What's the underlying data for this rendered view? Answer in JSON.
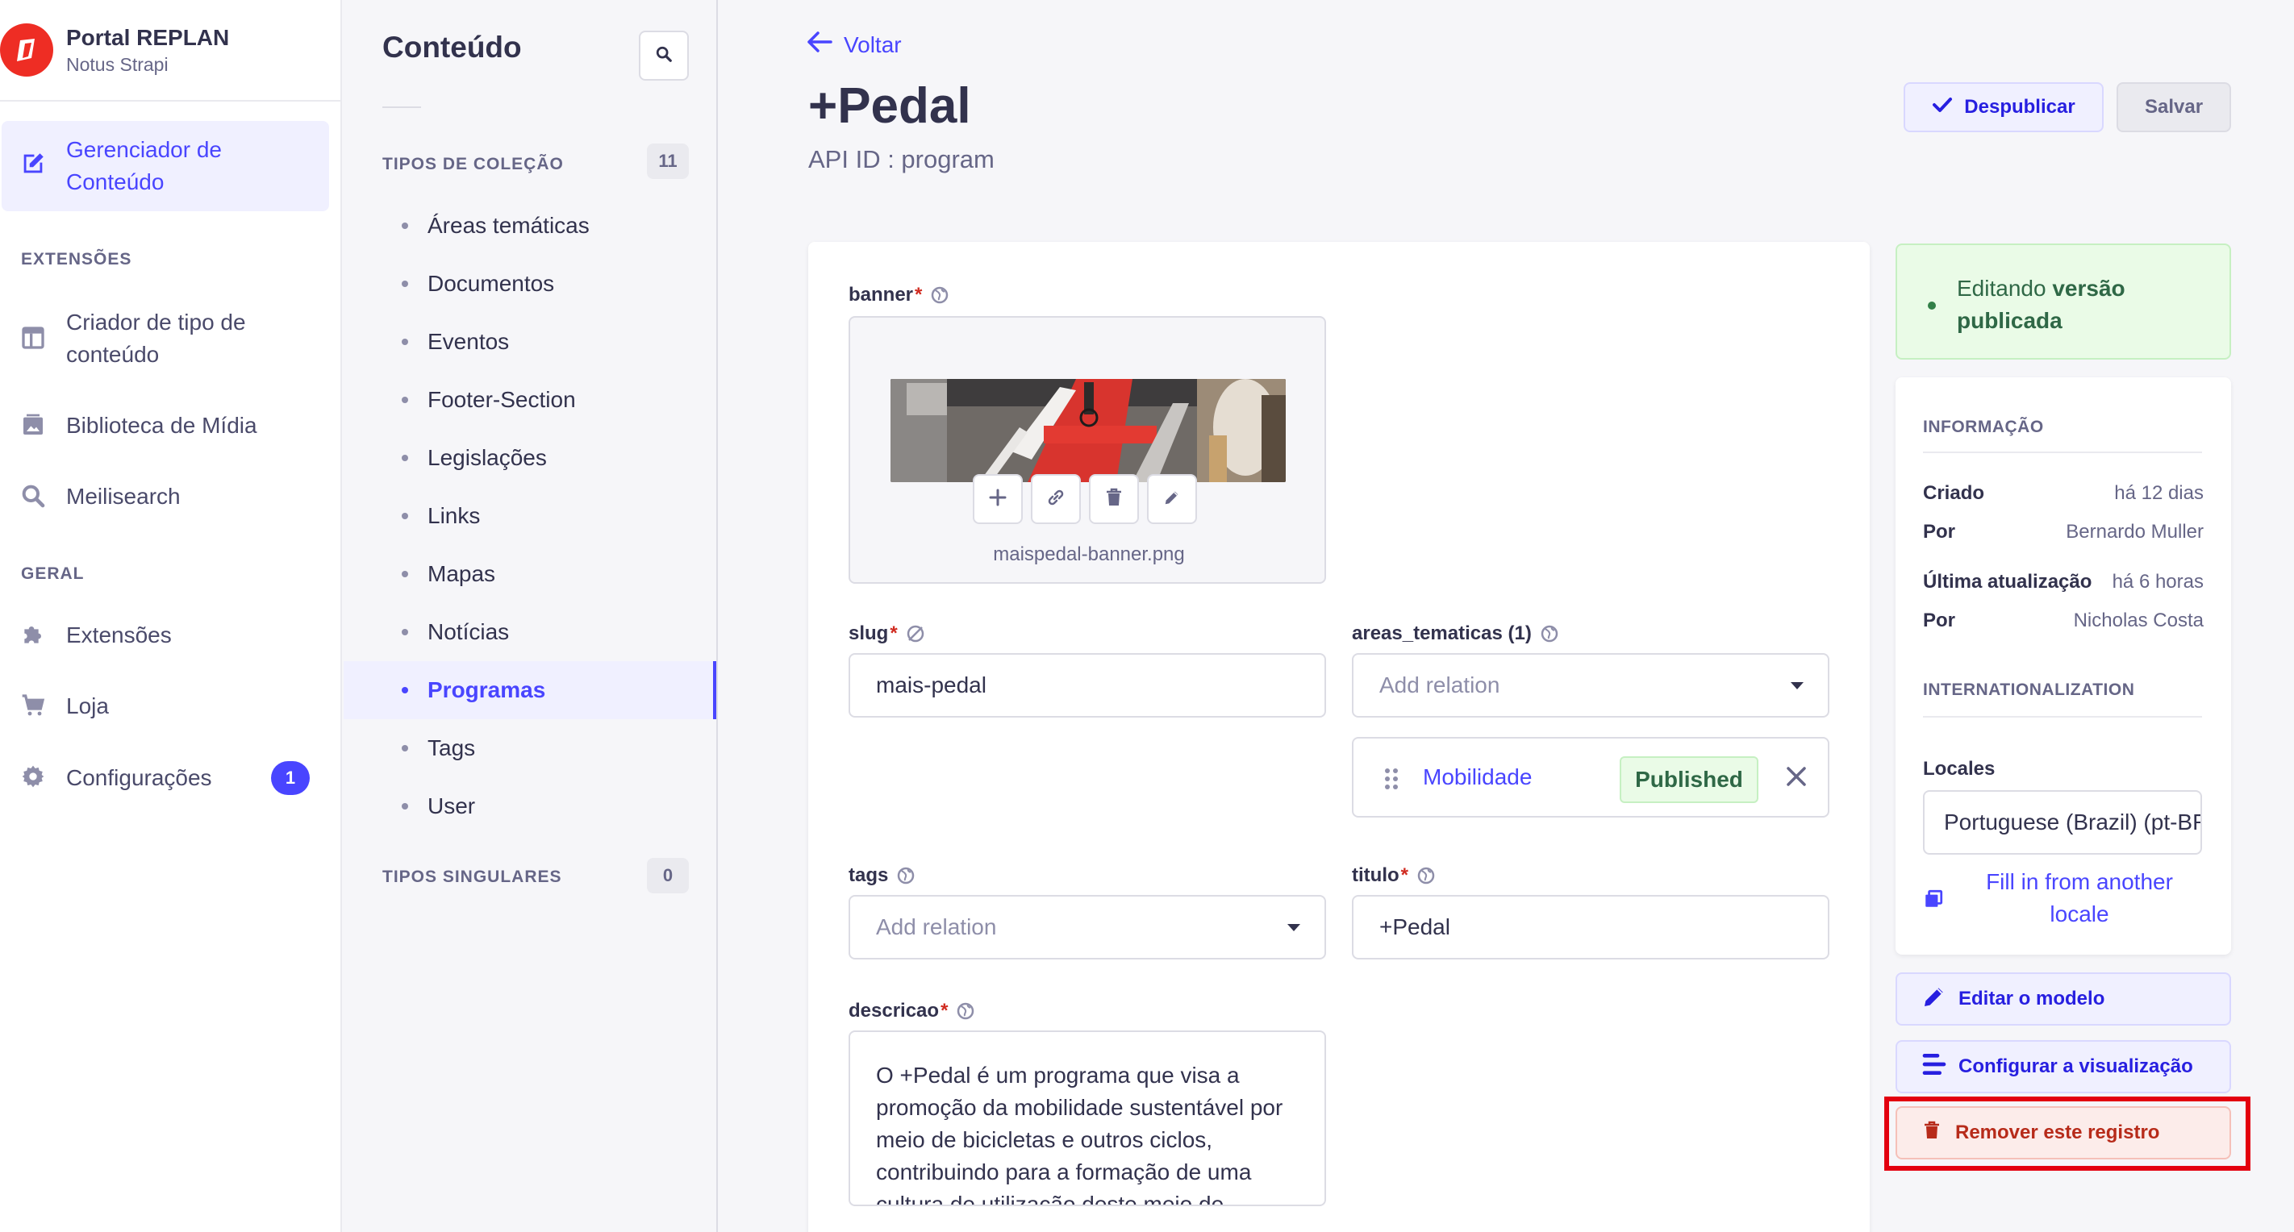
{
  "brand": {
    "title": "Portal REPLAN",
    "subtitle": "Notus Strapi"
  },
  "nav": {
    "content_manager": "Gerenciador de Conteúdo",
    "section_extensions": "EXTENSÕES",
    "content_type_builder": "Criador de tipo de conteúdo",
    "media_library": "Biblioteca de Mídia",
    "meilisearch": "Meilisearch",
    "section_general": "GERAL",
    "plugins": "Extensões",
    "marketplace": "Loja",
    "settings": "Configurações",
    "settings_badge": "1"
  },
  "subnav": {
    "title": "Conteúdo",
    "collection_types_label": "TIPOS DE COLEÇÃO",
    "collection_types_count": "11",
    "collection_types": [
      "Áreas temáticas",
      "Documentos",
      "Eventos",
      "Footer-Section",
      "Legislações",
      "Links",
      "Mapas",
      "Notícias",
      "Programas",
      "Tags",
      "User"
    ],
    "active_collection": "Programas",
    "single_types_label": "TIPOS SINGULARES",
    "single_types_count": "0"
  },
  "header": {
    "back_label": "Voltar",
    "title": "+Pedal",
    "api_id": "API ID : program",
    "unpublish_label": "Despublicar",
    "save_label": "Salvar"
  },
  "form": {
    "banner_label": "banner",
    "banner_filename": "maispedal-banner.png",
    "slug_label": "slug",
    "slug_value": "mais-pedal",
    "areas_label": "areas_tematicas (1)",
    "areas_placeholder": "Add relation",
    "relation_name": "Mobilidade",
    "relation_status": "Published",
    "tags_label": "tags",
    "tags_placeholder": "Add relation",
    "titulo_label": "titulo",
    "titulo_value": "+Pedal",
    "descricao_label": "descricao",
    "descricao_value": "O +Pedal é um programa que visa a promoção da mobilidade sustentável por meio de bicicletas e outros ciclos, contribuindo para a formação de uma cultura de utilização deste meio de",
    "required_mark": "*"
  },
  "sidebar": {
    "status_prefix": "Editando ",
    "status_bold": "versão publicada",
    "info_header": "INFORMAÇÃO",
    "created_label": "Criado",
    "created_value": "há 12 dias",
    "created_by_label": "Por",
    "created_by_value": "Bernardo Muller",
    "updated_label": "Última atualização",
    "updated_value": "há 6 horas",
    "updated_by_label": "Por",
    "updated_by_value": "Nicholas Costa",
    "i18n_header": "INTERNATIONALIZATION",
    "locales_label": "Locales",
    "locale_value": "Portuguese (Brazil) (pt-BR)",
    "fill_locale": "Fill in from another locale",
    "edit_model": "Editar o modelo",
    "configure_view": "Configurar a visualização",
    "delete_entry": "Remover este registro"
  },
  "colors": {
    "accent": "#4945ff",
    "danger": "#d02b20",
    "success": "#328048",
    "highlight": "#e3000f"
  }
}
